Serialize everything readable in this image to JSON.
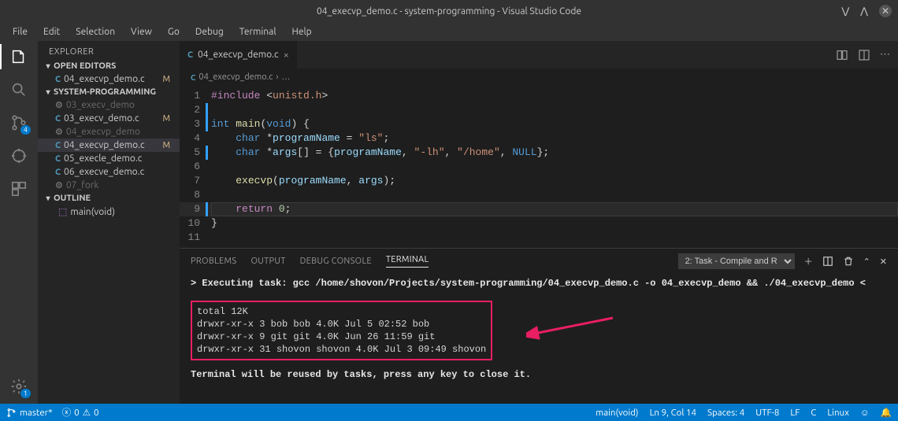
{
  "titlebar": {
    "title": "04_execvp_demo.c - system-programming - Visual Studio Code"
  },
  "menu": [
    "File",
    "Edit",
    "Selection",
    "View",
    "Go",
    "Debug",
    "Terminal",
    "Help"
  ],
  "activitybar": {
    "scm_badge": "4",
    "gear_badge": "1"
  },
  "sidebar": {
    "title": "EXPLORER",
    "openEditors": {
      "label": "OPEN EDITORS",
      "item": {
        "name": "04_execvp_demo.c",
        "status": "M"
      }
    },
    "project": {
      "label": "SYSTEM-PROGRAMMING",
      "files": [
        {
          "name": "03_execv_demo",
          "muted": true
        },
        {
          "name": "03_execv_demo.c",
          "status": "M"
        },
        {
          "name": "04_execvp_demo",
          "muted": true
        },
        {
          "name": "04_execvp_demo.c",
          "status": "M",
          "selected": true
        },
        {
          "name": "05_execle_demo.c"
        },
        {
          "name": "06_execve_demo.c"
        },
        {
          "name": "07_fork",
          "muted": true
        }
      ]
    },
    "outline": {
      "label": "OUTLINE",
      "item": "main(void)"
    }
  },
  "editor": {
    "tab": {
      "name": "04_execvp_demo.c"
    },
    "breadcrumb": {
      "file": "04_execvp_demo.c",
      "sep": "›",
      "more": "…"
    },
    "code": {
      "l1": {
        "include": "#include",
        "lt": "<",
        "hdr": "unistd.h",
        "gt": ">"
      },
      "l3": {
        "int": "int",
        "main": "main",
        "void": "void",
        "ob": "(",
        "cb": ")",
        "oc": " {"
      },
      "l4": {
        "char": "char",
        "star": " *",
        "var": "programName",
        "eq": " = ",
        "str": "\"ls\"",
        "semi": ";"
      },
      "l5": {
        "char": "char",
        "star": " *",
        "var": "args",
        "br": "[] = {",
        "v1": "programName",
        "c": ", ",
        "s1": "\"-lh\"",
        "s2": "\"/home\"",
        "null": "NULL",
        "end": "};"
      },
      "l7": {
        "fn": "execvp",
        "op": "(",
        "a1": "programName",
        "c": ", ",
        "a2": "args",
        "cp": ");"
      },
      "l9": {
        "ret": "return",
        "sp": " ",
        "zero": "0",
        "semi": ";"
      },
      "l10": "}"
    }
  },
  "panel": {
    "tabs": {
      "problems": "PROBLEMS",
      "output": "OUTPUT",
      "debug": "DEBUG CONSOLE",
      "terminal": "TERMINAL"
    },
    "taskSelector": "2: Task - Compile and R",
    "terminal": {
      "exec_prefix": "> Executing task: ",
      "exec_cmd": "gcc /home/shovon/Projects/system-programming/04_execvp_demo.c -o 04_execvp_demo && ./04_execvp_demo ",
      "exec_suffix": "<",
      "output_lines": [
        "total 12K",
        "drwxr-xr-x  3 bob    bob    4.0K Jul  5 02:52 bob",
        "drwxr-xr-x  9 git    git    4.0K Jun 26 11:59 git",
        "drwxr-xr-x 31 shovon shovon 4.0K Jul  3 09:49 shovon"
      ],
      "reuse": "Terminal will be reused by tasks, press any key to close it."
    }
  },
  "statusbar": {
    "branch": "master*",
    "errors": "0",
    "warnings": "0",
    "scope": "main(void)",
    "pos": "Ln 9, Col 14",
    "spaces": "Spaces: 4",
    "encoding": "UTF-8",
    "eol": "LF",
    "lang": "C",
    "os": "Linux"
  }
}
